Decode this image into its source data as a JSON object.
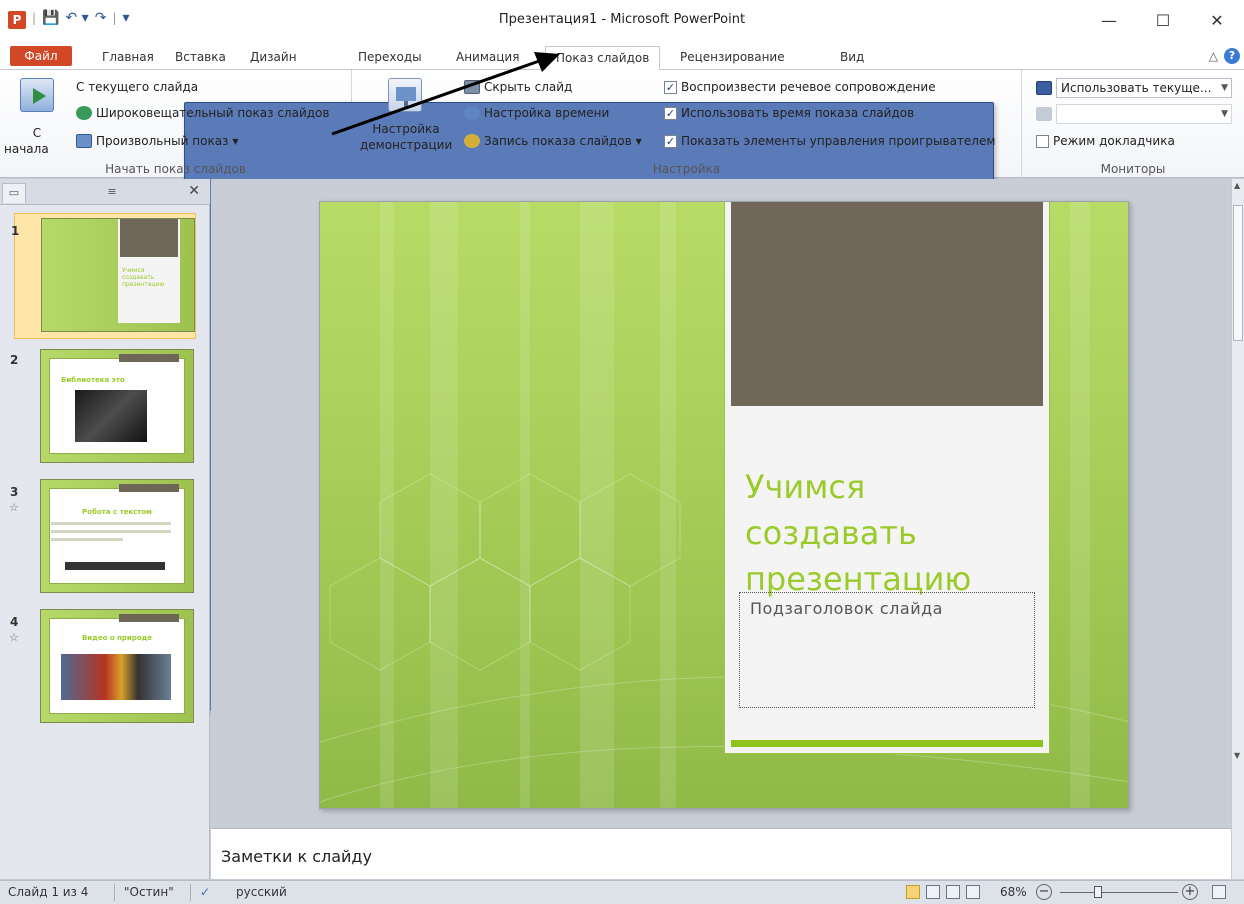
{
  "window": {
    "title": "Презентация1 - Microsoft PowerPoint",
    "app_icon": "P",
    "controls": {
      "minimize": "—",
      "maximize": "☐",
      "close": "✕"
    }
  },
  "qat": {
    "save": "💾",
    "undo": "↶ ▾",
    "redo": "↷",
    "customize": "▾"
  },
  "tabs": [
    {
      "label": "Файл"
    },
    {
      "label": "Главная"
    },
    {
      "label": "Вставка"
    },
    {
      "label": "Дизайн"
    },
    {
      "label": "Переходы"
    },
    {
      "label": "Анимация"
    },
    {
      "label": "Показ слайдов"
    },
    {
      "label": "Рецензирование"
    },
    {
      "label": "Вид"
    }
  ],
  "ribbon": {
    "start_group": {
      "label": "Начать показ слайдов",
      "from_start_line1": "С",
      "from_start_line2": "начала",
      "from_current": "С текущего слайда",
      "broadcast": "Широковещательный показ слайдов",
      "custom_show": "Произвольный показ"
    },
    "setup_group": {
      "label": "Настройка",
      "setup_show_line1": "Настройка",
      "setup_show_line2": "демонстрации",
      "hide_slide": "Скрыть слайд",
      "rehearse": "Настройка времени",
      "record": "Запись показа слайдов",
      "play_narrations": "Воспроизвести речевое сопровождение",
      "use_timings": "Использовать время показа слайдов",
      "show_controls": "Показать элементы управления проигрывателем"
    },
    "monitors_group": {
      "label": "Мониторы",
      "show_on": "Использовать текуще...",
      "resolution": "",
      "presenter_view": "Режим докладчика"
    }
  },
  "slides_panel": {
    "close": "✕",
    "thumbnails": [
      {
        "number": "1",
        "text": "Учимся создавать презентацию"
      },
      {
        "number": "2",
        "text": "Библиотека это"
      },
      {
        "number": "3",
        "text": "Робота с текстом",
        "star": "☆"
      },
      {
        "number": "4",
        "text": "Видео о природе",
        "star": "☆"
      }
    ]
  },
  "slide": {
    "title": "Учимся создавать презентацию",
    "title_line1": "Учимся",
    "title_line2": "создавать",
    "title_line3": "презентацию",
    "subtitle": "Подзаголовок слайда"
  },
  "notes": {
    "placeholder": "Заметки к слайду"
  },
  "status": {
    "slide_info": "Слайд 1 из 4",
    "theme": "\"Остин\"",
    "language": "русский",
    "zoom": "68%"
  }
}
